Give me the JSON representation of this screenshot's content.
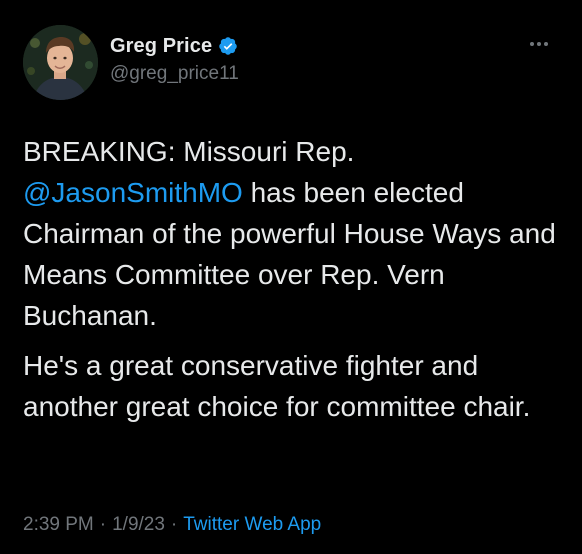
{
  "author": {
    "display_name": "Greg Price",
    "handle": "@greg_price11",
    "verified": true,
    "verified_color": "#1d9bf0"
  },
  "menu": {
    "icon": "more-horizontal-icon"
  },
  "tweet": {
    "para1_before": "BREAKING: Missouri Rep.",
    "mention": "@JasonSmithMO",
    "para1_after": " has been elected Chairman of the powerful House Ways and Means Committee over Rep. Vern Buchanan.",
    "para2": "He's a great conservative fighter and another great choice for committee chair."
  },
  "meta": {
    "time": "2:39 PM",
    "sep1": "·",
    "date": "1/9/23",
    "sep2": "·",
    "source": "Twitter Web App"
  },
  "colors": {
    "background": "#000000",
    "text": "#e7e9ea",
    "secondary": "#71767b",
    "accent": "#1d9bf0"
  }
}
